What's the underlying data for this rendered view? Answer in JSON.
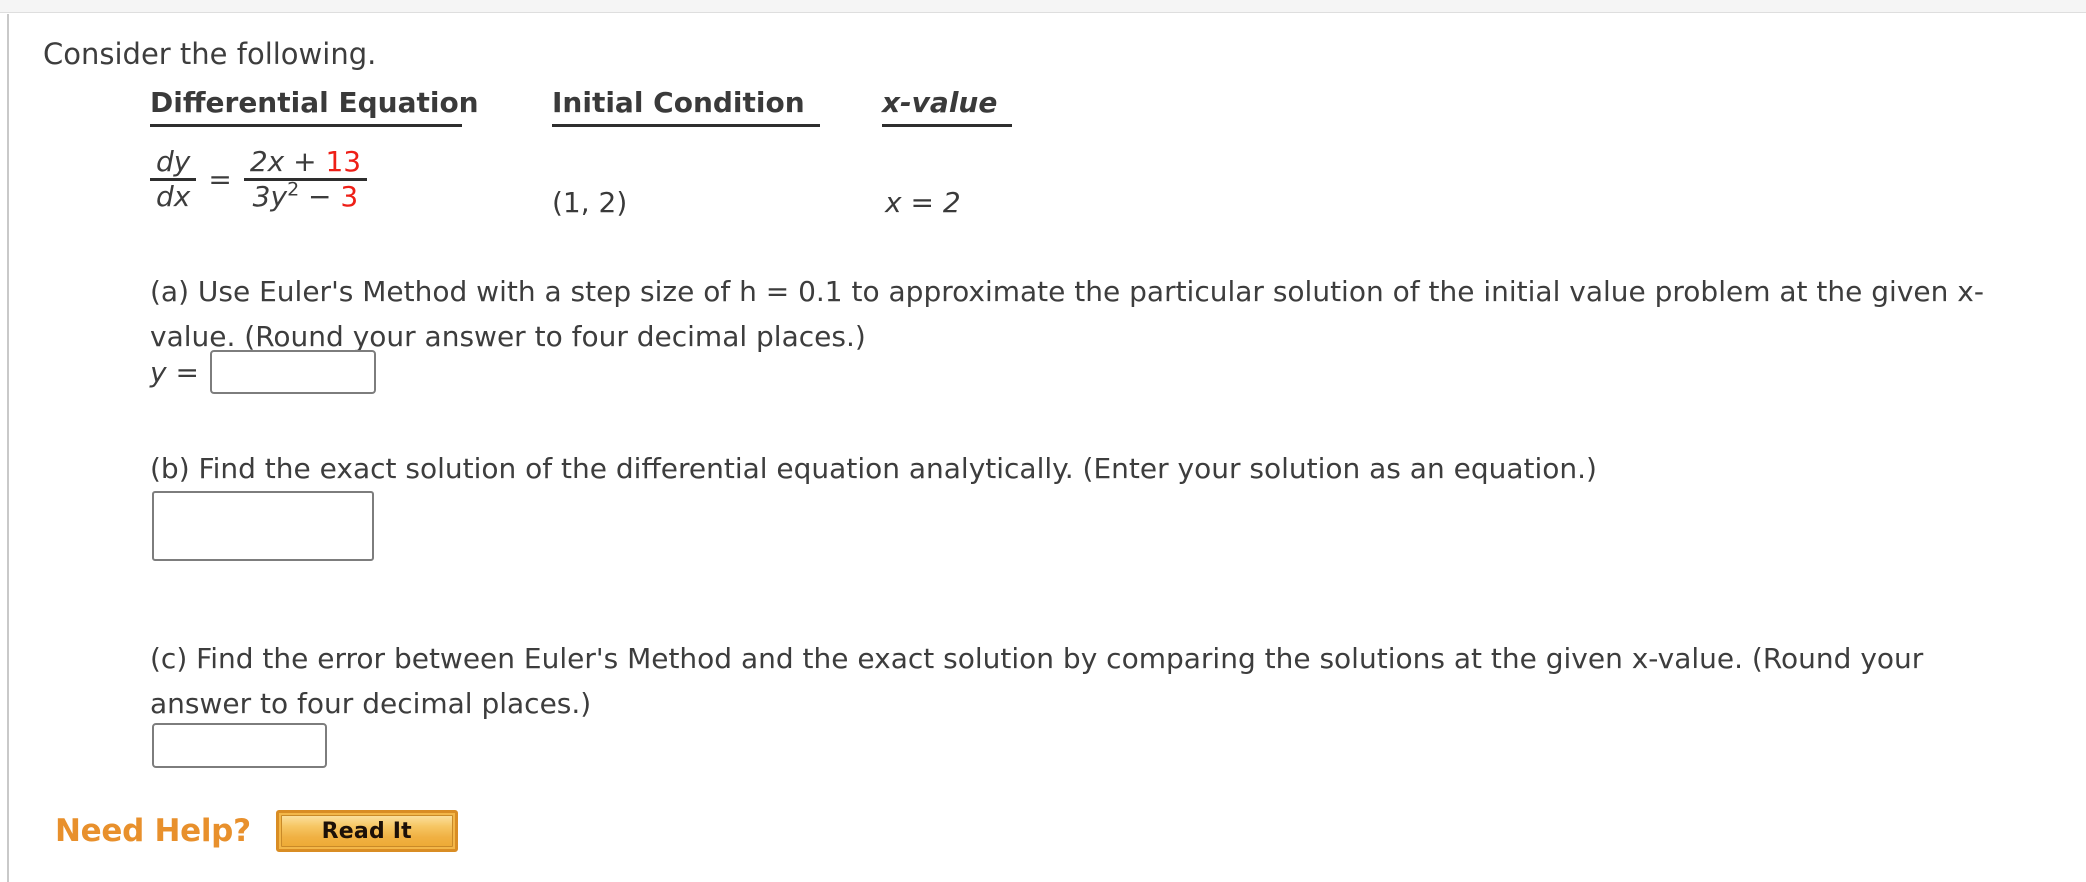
{
  "intro": "Consider the following.",
  "table": {
    "headers": {
      "differential_equation": "Differential Equation",
      "initial_condition": "Initial Condition",
      "x_value": "x-value"
    },
    "equation": {
      "lhs_num": "dy",
      "lhs_den": "dx",
      "equals": "=",
      "rhs_num_plain": "2x + ",
      "rhs_num_red": "13",
      "rhs_den_plain_a": "3y",
      "rhs_den_exp": "2",
      "rhs_den_plain_b": " − ",
      "rhs_den_red": "3"
    },
    "initial_condition_value": "(1, 2)",
    "x_value_value": "x = 2"
  },
  "parts": {
    "a": {
      "text": "(a) Use Euler's Method with a step size of h = 0.1 to approximate the particular solution of the initial value problem at the given x-value. (Round your answer to four decimal places.)",
      "answer_label": "y =",
      "answer_value": "",
      "answer_placeholder": ""
    },
    "b": {
      "text": "(b) Find the exact solution of the differential equation analytically. (Enter your solution as an equation.)",
      "answer_value": "",
      "answer_placeholder": ""
    },
    "c": {
      "text": "(c) Find the error between Euler's Method and the exact solution by comparing the solutions at the given x-value. (Round your answer to four decimal places.)",
      "answer_value": "",
      "answer_placeholder": ""
    }
  },
  "help": {
    "label": "Need Help?",
    "button_label": "Read It"
  },
  "colors": {
    "red_accent": "#ee1f17",
    "orange_accent": "#e8902c",
    "button_face": "#f3b749",
    "text": "#3d3d3d"
  }
}
